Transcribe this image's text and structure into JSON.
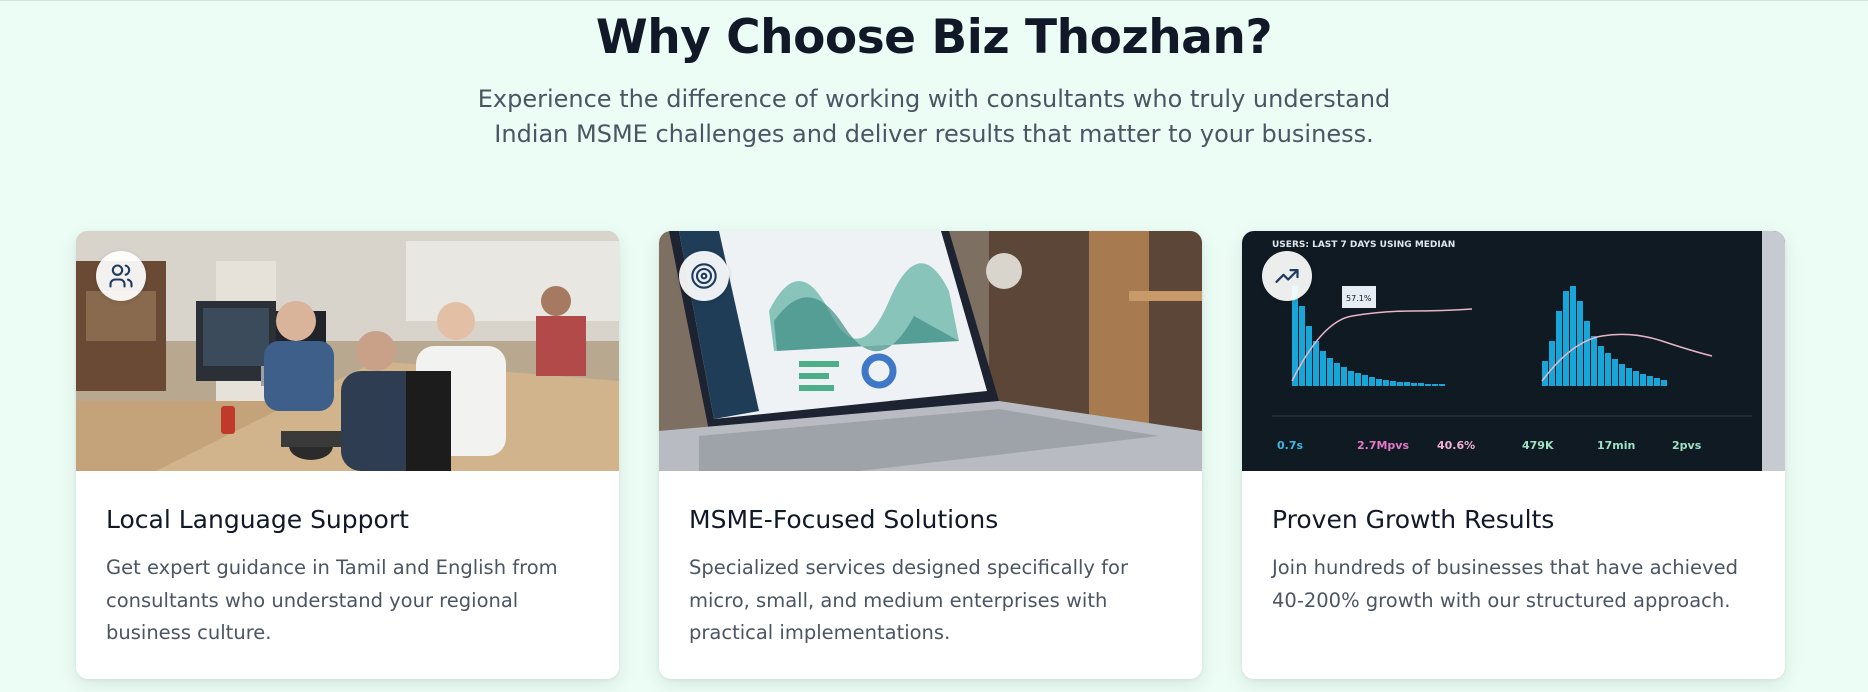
{
  "section": {
    "title": "Why Choose Biz Thozhan?",
    "subtitle": "Experience the difference of working with consultants who truly understand Indian MSME challenges and deliver results that matter to your business."
  },
  "cards": [
    {
      "title": "Local Language Support",
      "description": "Get expert guidance in Tamil and English from consultants who understand your regional business culture.",
      "icon": "users-icon"
    },
    {
      "title": "MSME-Focused Solutions",
      "description": "Specialized services designed specifically for micro, small, and medium enterprises with practical implementations.",
      "icon": "target-icon"
    },
    {
      "title": "Proven Growth Results",
      "description": "Join hundreds of businesses that have achieved 40-200% growth with our structured approach.",
      "icon": "trending-up-icon"
    }
  ],
  "analytics_photo": {
    "header": "USERS: LAST 7 DAYS USING MEDIAN",
    "tooltip": "57.1%",
    "stats": [
      "0.7s",
      "2.7Mpvs",
      "40.6%",
      "479K",
      "17min",
      "2pvs"
    ]
  },
  "colors": {
    "background": "#ecfdf5",
    "icon_stroke": "#1e3a5f",
    "title": "#111827",
    "body_text": "#4b5563"
  }
}
